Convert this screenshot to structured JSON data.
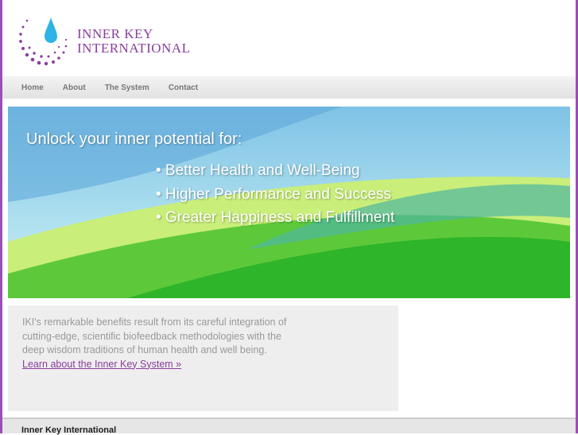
{
  "brand": {
    "name_line1": "Inner Key",
    "name_line2": "International"
  },
  "nav": {
    "items": [
      "Home",
      "About",
      "The System",
      "Contact"
    ]
  },
  "banner": {
    "headline": "Unlock your inner potential for:",
    "bullets": [
      "• Better Health and Well-Being",
      "• Higher Performance and Success",
      "• Greater Happiness and Fulfillment"
    ]
  },
  "info": {
    "text": "IKI's remarkable benefits result from its careful integration of cutting-edge, scientific biofeedback methodologies with the deep wisdom traditions of human health and well being.",
    "link": "Learn about the Inner Key System »"
  },
  "footer": {
    "title": "Inner Key International"
  },
  "colors": {
    "accent": "#8a3d9e",
    "droplet": "#2fb3e6"
  }
}
